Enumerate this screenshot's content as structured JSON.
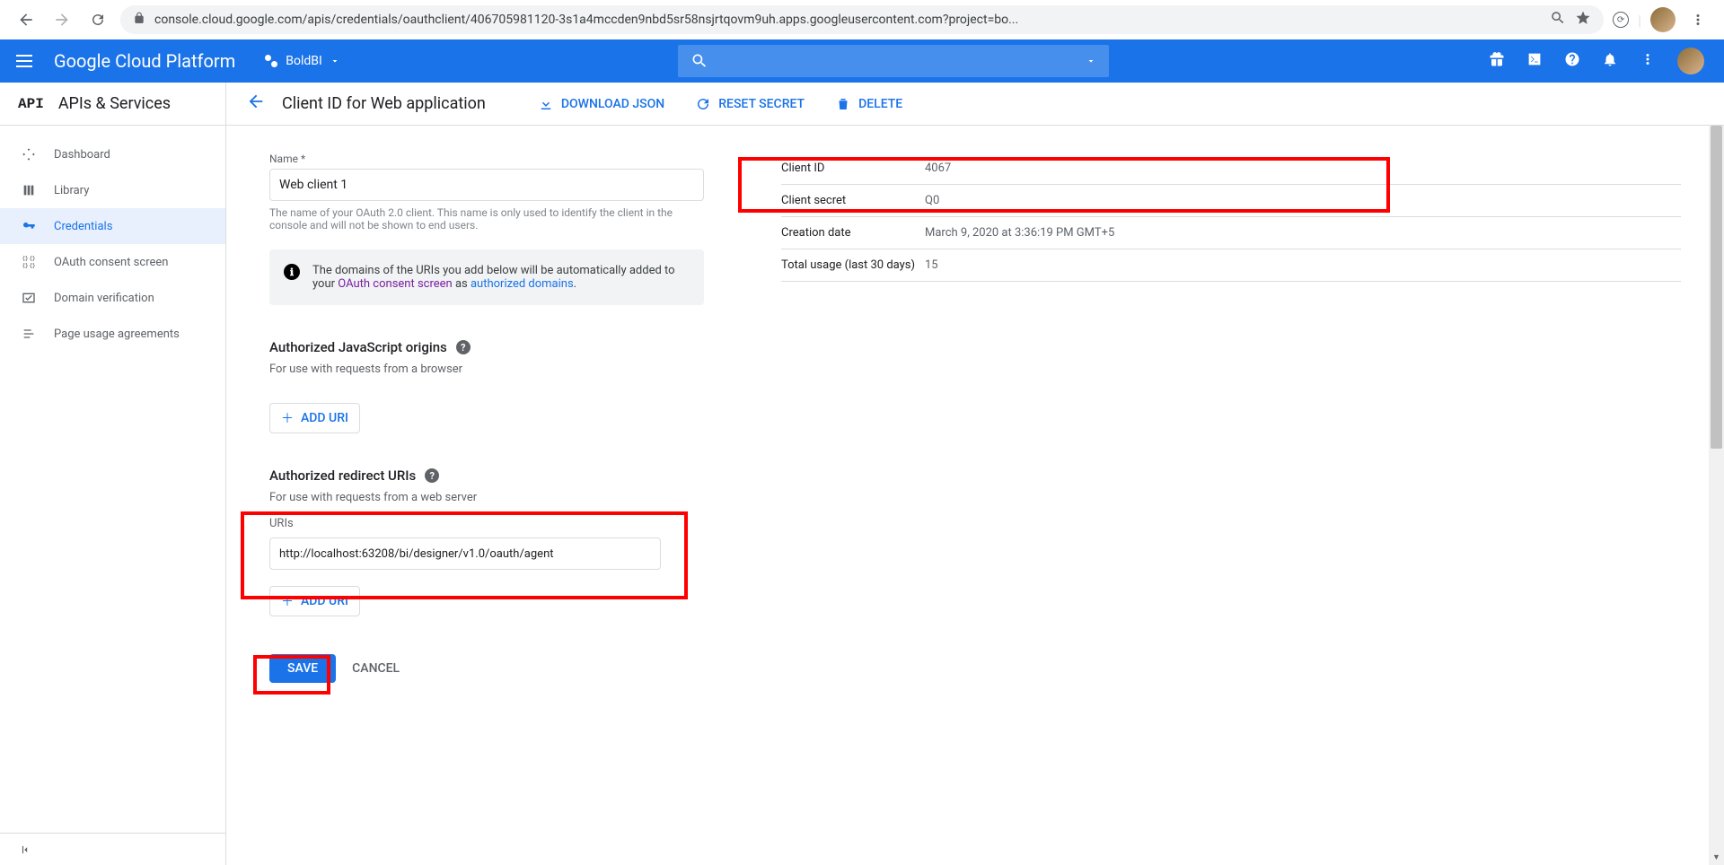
{
  "browser": {
    "url": "console.cloud.google.com/apis/credentials/oauthclient/406705981120-3s1a4mccden9nbd5sr58nsjrtqovm9uh.apps.googleusercontent.com?project=bo..."
  },
  "header": {
    "brand": "Google Cloud Platform",
    "project": "BoldBI"
  },
  "sidebar": {
    "title": "APIs & Services",
    "items": [
      {
        "label": "Dashboard"
      },
      {
        "label": "Library"
      },
      {
        "label": "Credentials"
      },
      {
        "label": "OAuth consent screen"
      },
      {
        "label": "Domain verification"
      },
      {
        "label": "Page usage agreements"
      }
    ]
  },
  "actionbar": {
    "title": "Client ID for Web application",
    "actions": {
      "download": "DOWNLOAD JSON",
      "reset": "RESET SECRET",
      "delete": "DELETE"
    }
  },
  "form": {
    "name_label": "Name *",
    "name_value": "Web client 1",
    "name_helper": "The name of your OAuth 2.0 client. This name is only used to identify the client in the console and will not be shown to end users.",
    "info_pre": "The domains of the URIs you add below will be automatically added to your ",
    "info_link1": "OAuth consent screen",
    "info_mid": " as ",
    "info_link2": "authorized domains",
    "info_post": ".",
    "js_origins_title": "Authorized JavaScript origins",
    "js_origins_sub": "For use with requests from a browser",
    "redirect_title": "Authorized redirect URIs",
    "redirect_sub": "For use with requests from a web server",
    "uris_label": "URIs",
    "uri_value": "http://localhost:63208/bi/designer/v1.0/oauth/agent",
    "add_uri": "ADD URI",
    "save": "SAVE",
    "cancel": "CANCEL"
  },
  "details": {
    "rows": [
      {
        "k": "Client ID",
        "v": "4067"
      },
      {
        "k": "Client secret",
        "v": "Q0"
      },
      {
        "k": "Creation date",
        "v": "March 9, 2020 at 3:36:19 PM GMT+5"
      },
      {
        "k": "Total usage (last 30 days)",
        "v": "15"
      }
    ]
  }
}
